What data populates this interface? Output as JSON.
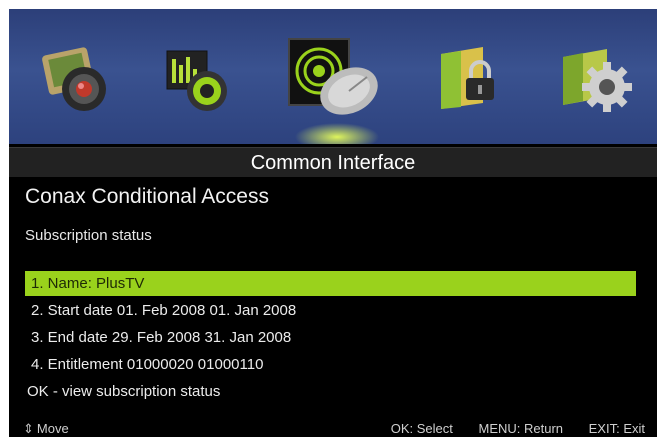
{
  "menu": {
    "icons": [
      "media-camera-icon",
      "settings-dial-icon",
      "satellite-dish-icon",
      "lock-icon",
      "gear-icon"
    ],
    "selected_index": 2,
    "title": "Common Interface"
  },
  "module": {
    "title": "Conax Conditional Access",
    "subtitle": "Subscription status"
  },
  "list": {
    "items": [
      "1. Name:  PlusTV",
      "2. Start date 01. Feb 2008   01. Jan 2008",
      "3. End date 29. Feb 2008   31. Jan 2008",
      "4. Entitlement 01000020   01000110"
    ],
    "selected_index": 0,
    "hint": "OK - view subscription status"
  },
  "footer": {
    "move_icon": "up-down-arrow-icon",
    "move": "Move",
    "select": "OK: Select",
    "return": "MENU: Return",
    "exit": "EXIT: Exit"
  },
  "colors": {
    "highlight": "#9ad21c",
    "icon_bar": "#3a5290"
  }
}
